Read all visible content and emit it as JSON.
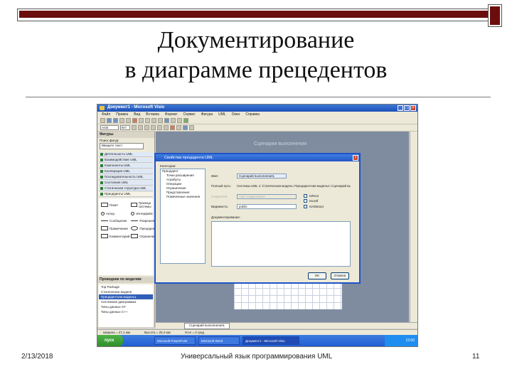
{
  "slide": {
    "title_line1": "Документирование",
    "title_line2": "в диаграмме прецедентов",
    "footer_date": "2/13/2018",
    "footer_center": "Универсальный язык программирования UML",
    "page_number": "11",
    "accent_color": "#6b0d0d"
  },
  "app": {
    "window_title": "Документ1 - Microsoft Visio",
    "menu": [
      "Файл",
      "Правка",
      "Вид",
      "Вставка",
      "Формат",
      "Сервис",
      "Фигура",
      "UML",
      "Окно",
      "Справка"
    ],
    "font_name": "Arial",
    "font_size": "8пт",
    "shapes_panel": {
      "header": "Фигуры",
      "search_label": "Поиск фигур:",
      "search_placeholder": "Введите текст",
      "stencils": [
        "Деятельность UML",
        "Взаимодействие UML",
        "Компоненты UML",
        "Кооперация UML",
        "Последовательность UML",
        "Состояния UML",
        "Статическая структура UML",
        "Прецеденты UML"
      ],
      "shapes": [
        {
          "label": "Пакет",
          "icon": "package-icon"
        },
        {
          "label": "Граница системы",
          "icon": "system-boundary-icon"
        },
        {
          "label": "Актер",
          "icon": "actor-icon"
        },
        {
          "label": "Интерфейс",
          "icon": "interface-icon"
        },
        {
          "label": "Сообщение",
          "icon": "message-icon"
        },
        {
          "label": "Разрешение",
          "icon": "permission-icon"
        },
        {
          "label": "Примечание",
          "icon": "note-icon"
        },
        {
          "label": "Прецедент",
          "icon": "use-case-icon"
        },
        {
          "label": "Комментарий",
          "icon": "comment-icon"
        },
        {
          "label": "Ограничение",
          "icon": "constraint-icon"
        }
      ]
    },
    "model_explorer": {
      "header": "Проводник по моделям",
      "items": [
        "Top Package",
        "Статические модели",
        "Прецедентная модель1",
        "Системная диаграмма1",
        "Типы данных C#",
        "Типы данных C++"
      ]
    },
    "canvas_title": "Сценарии выполнения",
    "page_tab": "Сценарий выполнения1",
    "status": {
      "width": "Ширина = 27,1 мм",
      "height": "Высота = 25,4 мм",
      "angle": "Угол = 0 град"
    },
    "taskbar": {
      "start": "пуск",
      "tasks": [
        "Microsoft PowerPoint",
        "Microsoft Word",
        "Документ1 - Microsoft Visio"
      ],
      "clock": "12:00"
    }
  },
  "dialog": {
    "title": "Свойства прецедента UML",
    "categories_label": "Категории:",
    "categories": [
      "Прецедент",
      "Точки расширения",
      "Атрибуты",
      "Операции",
      "Ограничения",
      "Представления",
      "Помеченные значения"
    ],
    "name_label": "Имя:",
    "name_value": "Сценарий выполнения1",
    "path_label": "Полный путь:",
    "path_value": "Системы UML 1::Статическая модель::Прецедентная модель1::Сценарий выполнения1",
    "stereotype_label": "Стереотип:",
    "stereotype_value": "<нет стереотипа>",
    "visibility_label": "Видимость:",
    "visibility_value": "public",
    "is_root": "IsRoot",
    "is_leaf": "IsLeaf",
    "is_abstract": "IsAbstract",
    "doc_label": "Документирование:",
    "ok": "OK",
    "cancel": "Отмена"
  }
}
